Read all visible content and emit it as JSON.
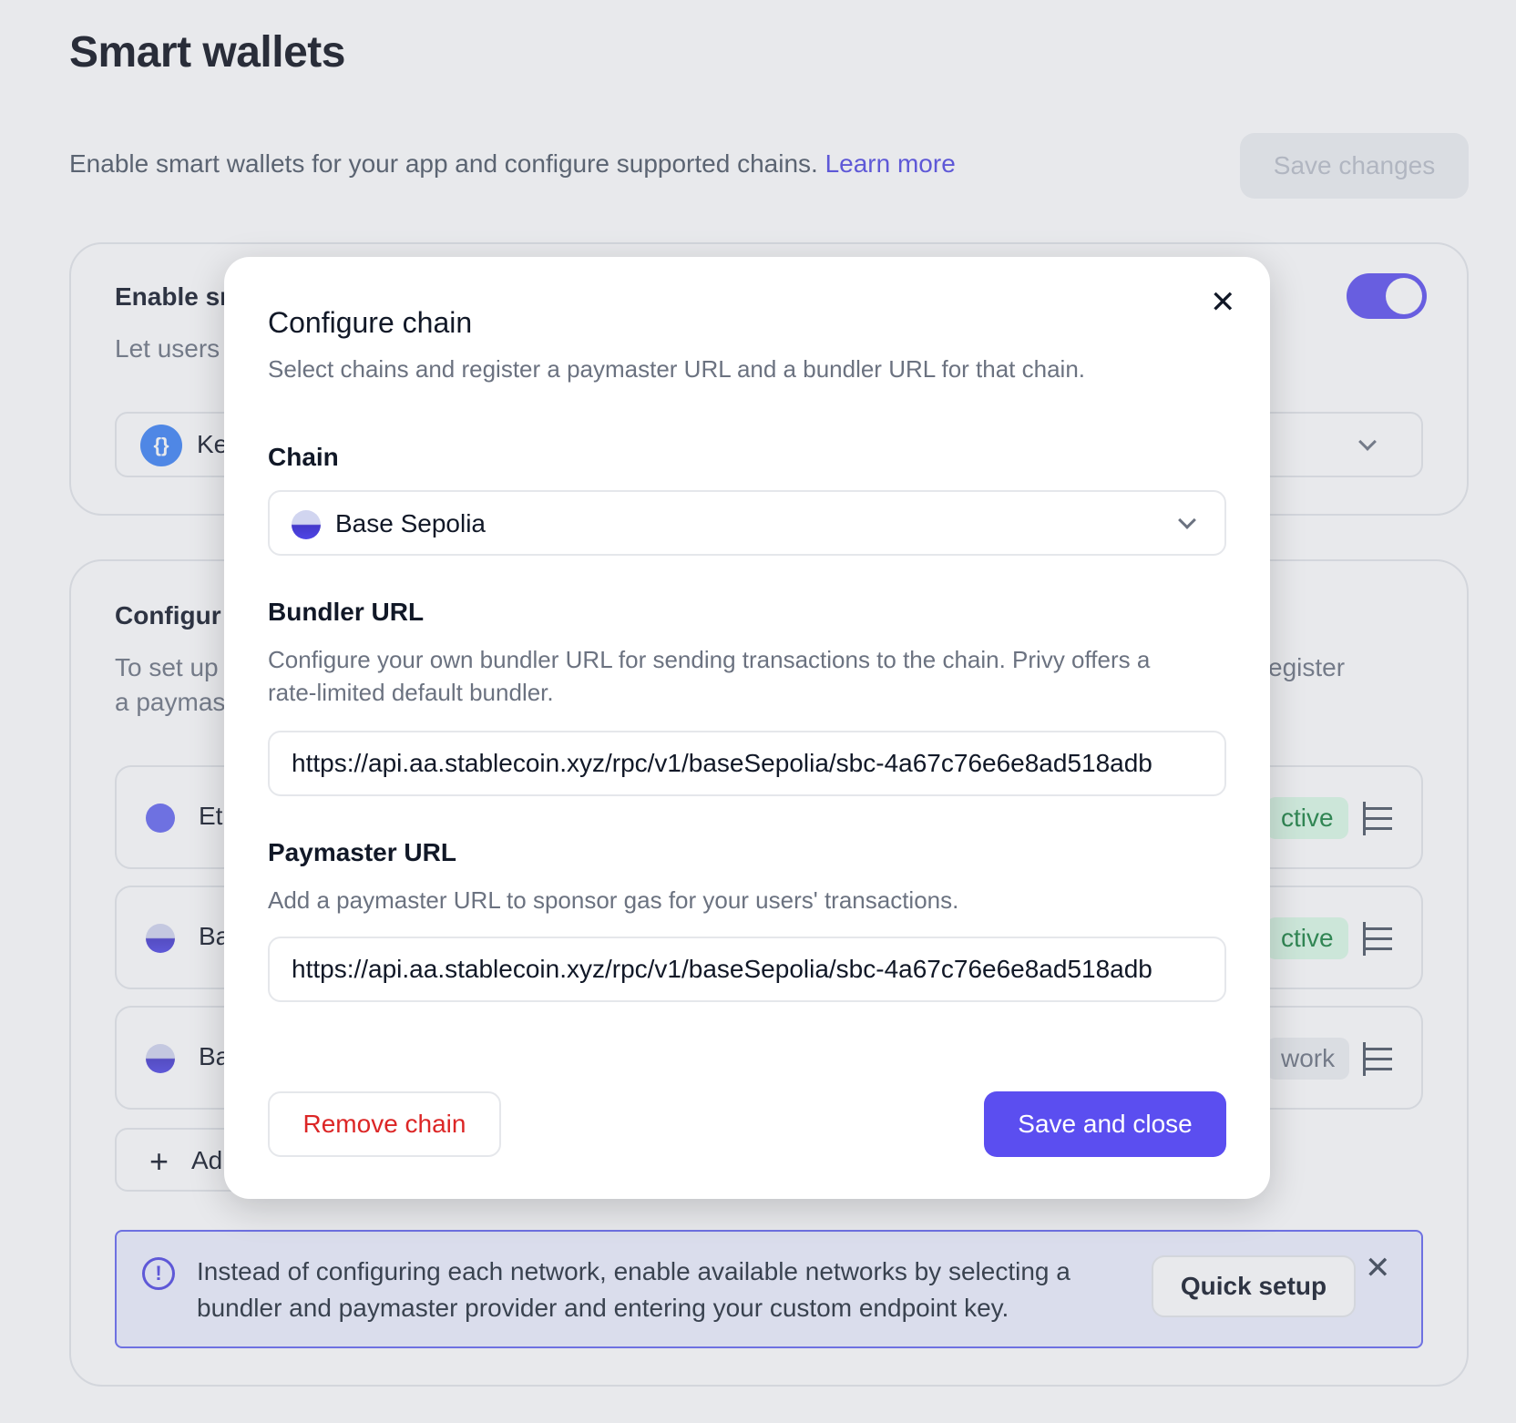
{
  "page": {
    "title": "Smart wallets",
    "description": "Enable smart wallets for your app and configure supported chains.",
    "learn_more": "Learn more",
    "save_changes": "Save changes"
  },
  "enable_card": {
    "title": "Enable sr",
    "subtitle": "Let users",
    "provider_label": "Ke",
    "toggle_on": true
  },
  "configure_card": {
    "title": "Configur",
    "desc_line1": "To set up",
    "desc_line1_right": "egister",
    "desc_line2": "a paymas",
    "chains": [
      {
        "name": "Etl",
        "badge": "ctive",
        "badge_style": "green"
      },
      {
        "name": "Ba",
        "badge": "ctive",
        "badge_style": "green"
      },
      {
        "name": "Ba",
        "badge": "work",
        "badge_style": "gray"
      }
    ],
    "add_label": "Ad"
  },
  "info_box": {
    "message": "Instead of configuring each network, enable available networks by selecting a bundler and paymaster provider and entering your custom endpoint key.",
    "quick_setup": "Quick setup",
    "close": "✕"
  },
  "modal": {
    "title": "Configure chain",
    "subtitle": "Select chains and register a paymaster URL and a bundler URL for that chain.",
    "close": "✕",
    "chain_label": "Chain",
    "chain_value": "Base Sepolia",
    "bundler_label": "Bundler URL",
    "bundler_help": "Configure your own bundler URL for sending transactions to the chain. Privy offers a rate-limited default bundler.",
    "bundler_value": "https://api.aa.stablecoin.xyz/rpc/v1/baseSepolia/sbc-4a67c76e6e8ad518adb",
    "paymaster_label": "Paymaster URL",
    "paymaster_help": "Add a paymaster URL to sponsor gas for your users' transactions.",
    "paymaster_value": "https://api.aa.stablecoin.xyz/rpc/v1/baseSepolia/sbc-4a67c76e6e8ad518adb",
    "remove_button": "Remove chain",
    "save_button": "Save and close"
  },
  "colors": {
    "accent": "#5b4ef0",
    "link": "#4f46e5",
    "danger": "#dc2626",
    "active_badge_bg": "#dcfce7"
  }
}
